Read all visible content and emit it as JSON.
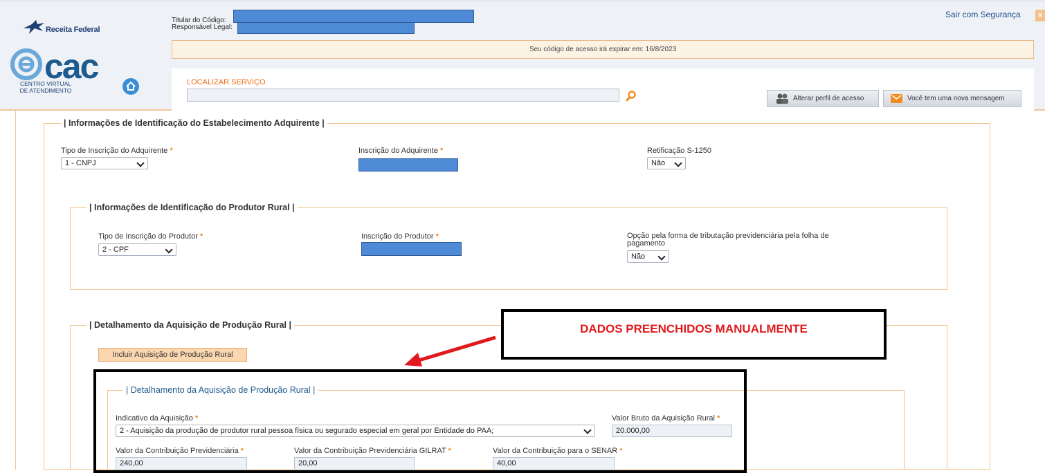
{
  "header": {
    "agency_logo": "Receita Federal",
    "ecac_logo": "cac",
    "ecac_subtitle": "CENTRO VIRTUAL DE ATENDIMENTO",
    "holder_label": "Titular do Código:",
    "legal_label": "Responsável Legal:",
    "expire_notice": "Seu código de acesso irá expirar em: 16/8/2023",
    "search_label": "LOCALIZAR SERVIÇO",
    "search_placeholder": "",
    "profile_button": "Alterar perfil de acesso",
    "message_button": "Você tem uma nova mensagem",
    "logout": "Sair com Segurança",
    "logout_close": "x"
  },
  "section_adquirente": {
    "legend": "| Informações de Identificação do Estabelecimento Adquirente |",
    "tipo_label": "Tipo de Inscrição do Adquirente",
    "tipo_value": "1 - CNPJ",
    "inscricao_label": "Inscrição do Adquirente",
    "retificacao_label": "Retificação S-1250",
    "retificacao_value": "Não",
    "required_mark": "*"
  },
  "section_produtor": {
    "legend": "| Informações de Identificação do Produtor Rural |",
    "tipo_label": "Tipo de Inscrição do Produtor",
    "tipo_value": "2 - CPF",
    "inscricao_label": "Inscrição do Produtor",
    "opcao_label_1": "Opção pela forma de tributação previdenciária pela folha de",
    "opcao_label_2": "pagamento",
    "opcao_value": "Não"
  },
  "section_detalhamento": {
    "legend": "| Detalhamento da Aquisição de Produção Rural |",
    "include_button": "Incluir Aquisição de Produção Rural",
    "inner_legend": "| Detalhamento da Aquisição de Produção Rural |",
    "indicativo_label": "Indicativo da Aquisição",
    "indicativo_value": "2 - Aquisição da produção de produtor rural pessoa física ou segurado especial em geral por Entidade do PAA;",
    "valor_bruto_label": "Valor Bruto da Aquisição Rural",
    "valor_bruto_value": "20.000,00",
    "contrib_prev_label": "Valor da Contribuição Previdenciária",
    "contrib_prev_value": "240,00",
    "gilrat_label": "Valor da Contribuição Previdenciária GILRAT",
    "gilrat_value": "20,00",
    "senar_label": "Valor da Contribuição para o SENAR",
    "senar_value": "40,00"
  },
  "annotation": {
    "text": "DADOS PREENCHIDOS MANUALMENTE"
  },
  "colors": {
    "accent_orange": "#f08b1d",
    "link_blue": "#1d4f8e",
    "annotation_red": "#e1191d",
    "redaction_blue": "#4f8ad6"
  }
}
